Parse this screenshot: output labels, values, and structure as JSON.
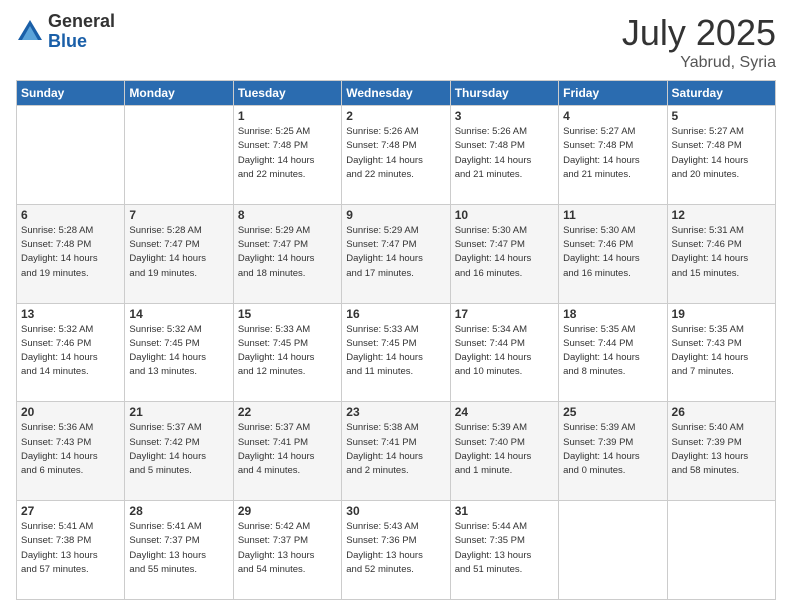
{
  "header": {
    "logo_general": "General",
    "logo_blue": "Blue",
    "month": "July 2025",
    "location": "Yabrud, Syria"
  },
  "days_of_week": [
    "Sunday",
    "Monday",
    "Tuesday",
    "Wednesday",
    "Thursday",
    "Friday",
    "Saturday"
  ],
  "weeks": [
    [
      {
        "day": "",
        "info": ""
      },
      {
        "day": "",
        "info": ""
      },
      {
        "day": "1",
        "info": "Sunrise: 5:25 AM\nSunset: 7:48 PM\nDaylight: 14 hours\nand 22 minutes."
      },
      {
        "day": "2",
        "info": "Sunrise: 5:26 AM\nSunset: 7:48 PM\nDaylight: 14 hours\nand 22 minutes."
      },
      {
        "day": "3",
        "info": "Sunrise: 5:26 AM\nSunset: 7:48 PM\nDaylight: 14 hours\nand 21 minutes."
      },
      {
        "day": "4",
        "info": "Sunrise: 5:27 AM\nSunset: 7:48 PM\nDaylight: 14 hours\nand 21 minutes."
      },
      {
        "day": "5",
        "info": "Sunrise: 5:27 AM\nSunset: 7:48 PM\nDaylight: 14 hours\nand 20 minutes."
      }
    ],
    [
      {
        "day": "6",
        "info": "Sunrise: 5:28 AM\nSunset: 7:48 PM\nDaylight: 14 hours\nand 19 minutes."
      },
      {
        "day": "7",
        "info": "Sunrise: 5:28 AM\nSunset: 7:47 PM\nDaylight: 14 hours\nand 19 minutes."
      },
      {
        "day": "8",
        "info": "Sunrise: 5:29 AM\nSunset: 7:47 PM\nDaylight: 14 hours\nand 18 minutes."
      },
      {
        "day": "9",
        "info": "Sunrise: 5:29 AM\nSunset: 7:47 PM\nDaylight: 14 hours\nand 17 minutes."
      },
      {
        "day": "10",
        "info": "Sunrise: 5:30 AM\nSunset: 7:47 PM\nDaylight: 14 hours\nand 16 minutes."
      },
      {
        "day": "11",
        "info": "Sunrise: 5:30 AM\nSunset: 7:46 PM\nDaylight: 14 hours\nand 16 minutes."
      },
      {
        "day": "12",
        "info": "Sunrise: 5:31 AM\nSunset: 7:46 PM\nDaylight: 14 hours\nand 15 minutes."
      }
    ],
    [
      {
        "day": "13",
        "info": "Sunrise: 5:32 AM\nSunset: 7:46 PM\nDaylight: 14 hours\nand 14 minutes."
      },
      {
        "day": "14",
        "info": "Sunrise: 5:32 AM\nSunset: 7:45 PM\nDaylight: 14 hours\nand 13 minutes."
      },
      {
        "day": "15",
        "info": "Sunrise: 5:33 AM\nSunset: 7:45 PM\nDaylight: 14 hours\nand 12 minutes."
      },
      {
        "day": "16",
        "info": "Sunrise: 5:33 AM\nSunset: 7:45 PM\nDaylight: 14 hours\nand 11 minutes."
      },
      {
        "day": "17",
        "info": "Sunrise: 5:34 AM\nSunset: 7:44 PM\nDaylight: 14 hours\nand 10 minutes."
      },
      {
        "day": "18",
        "info": "Sunrise: 5:35 AM\nSunset: 7:44 PM\nDaylight: 14 hours\nand 8 minutes."
      },
      {
        "day": "19",
        "info": "Sunrise: 5:35 AM\nSunset: 7:43 PM\nDaylight: 14 hours\nand 7 minutes."
      }
    ],
    [
      {
        "day": "20",
        "info": "Sunrise: 5:36 AM\nSunset: 7:43 PM\nDaylight: 14 hours\nand 6 minutes."
      },
      {
        "day": "21",
        "info": "Sunrise: 5:37 AM\nSunset: 7:42 PM\nDaylight: 14 hours\nand 5 minutes."
      },
      {
        "day": "22",
        "info": "Sunrise: 5:37 AM\nSunset: 7:41 PM\nDaylight: 14 hours\nand 4 minutes."
      },
      {
        "day": "23",
        "info": "Sunrise: 5:38 AM\nSunset: 7:41 PM\nDaylight: 14 hours\nand 2 minutes."
      },
      {
        "day": "24",
        "info": "Sunrise: 5:39 AM\nSunset: 7:40 PM\nDaylight: 14 hours\nand 1 minute."
      },
      {
        "day": "25",
        "info": "Sunrise: 5:39 AM\nSunset: 7:39 PM\nDaylight: 14 hours\nand 0 minutes."
      },
      {
        "day": "26",
        "info": "Sunrise: 5:40 AM\nSunset: 7:39 PM\nDaylight: 13 hours\nand 58 minutes."
      }
    ],
    [
      {
        "day": "27",
        "info": "Sunrise: 5:41 AM\nSunset: 7:38 PM\nDaylight: 13 hours\nand 57 minutes."
      },
      {
        "day": "28",
        "info": "Sunrise: 5:41 AM\nSunset: 7:37 PM\nDaylight: 13 hours\nand 55 minutes."
      },
      {
        "day": "29",
        "info": "Sunrise: 5:42 AM\nSunset: 7:37 PM\nDaylight: 13 hours\nand 54 minutes."
      },
      {
        "day": "30",
        "info": "Sunrise: 5:43 AM\nSunset: 7:36 PM\nDaylight: 13 hours\nand 52 minutes."
      },
      {
        "day": "31",
        "info": "Sunrise: 5:44 AM\nSunset: 7:35 PM\nDaylight: 13 hours\nand 51 minutes."
      },
      {
        "day": "",
        "info": ""
      },
      {
        "day": "",
        "info": ""
      }
    ]
  ]
}
